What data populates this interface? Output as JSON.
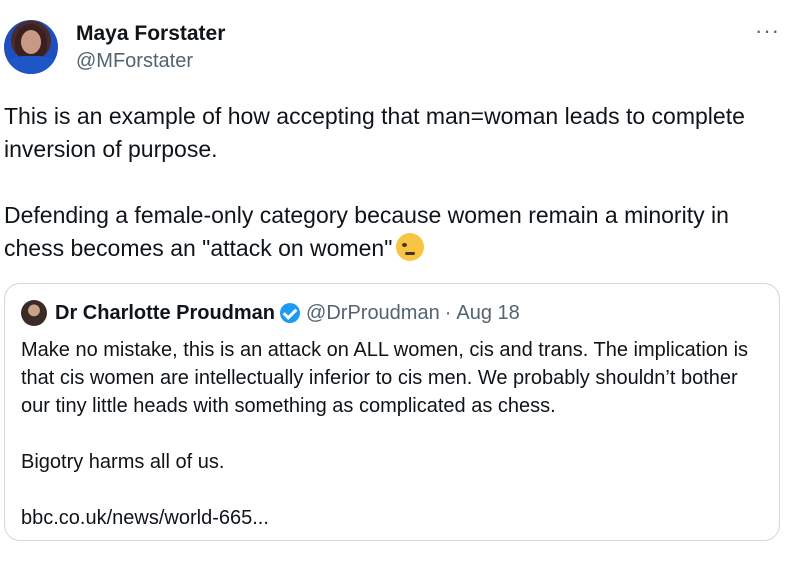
{
  "author": {
    "name": "Maya Forstater",
    "handle": "@MForstater"
  },
  "menu": {
    "more_label": "···"
  },
  "tweet": {
    "paragraph1": "This is an example of how accepting that man=woman leads to complete inversion of purpose.",
    "paragraph2": "Defending a female-only category because women remain a minority in chess becomes an \"attack on women\"",
    "emoji_icon": "face-with-rolling-eyes"
  },
  "quoted": {
    "name": "Dr Charlotte Proudman",
    "verified_icon": "verified-badge-icon",
    "handle": "@DrProudman",
    "separator": "·",
    "date": "Aug 18",
    "paragraph1": "Make no mistake, this is an attack on ALL women, cis and trans. The implication is that cis women are intellectually inferior to cis men. We probably shouldn’t bother our tiny little heads with something as complicated as chess.",
    "paragraph2": "Bigotry harms all of us.",
    "link": "bbc.co.uk/news/world-665..."
  },
  "colors": {
    "text": "#0f1419",
    "secondary": "#536471",
    "verified": "#1d9bf0",
    "border": "#cfd9de"
  }
}
